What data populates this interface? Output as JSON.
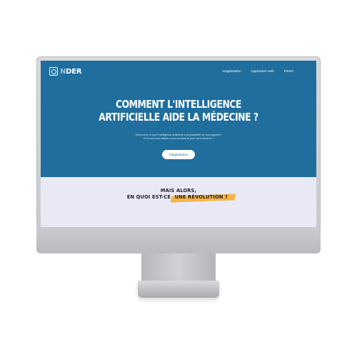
{
  "brand": {
    "logo_prefix": "N",
    "logo_suffix": "DER"
  },
  "nav": {
    "items": [
      {
        "label": "Vulgarisation"
      },
      {
        "label": "Application web"
      },
      {
        "label": "Forum"
      }
    ]
  },
  "hero": {
    "title_line1": "COMMENT L'INTELLIGENCE",
    "title_line2": "ARTIFICIELLE AIDE LA MÉDECINE ?",
    "subtitle_line1": "Découvrez ce que l'intelligence artificielle a la possibilité de vous apporter.",
    "subtitle_line2": "Et si cela vous effraie, nous sommes là pour vous informer !",
    "button_label": "Vulgarisation"
  },
  "section": {
    "line1": "MAIS ALORS,",
    "line2_prefix": "EN QUOI EST-CE ",
    "line2_highlight": "UNE RÉVOLUTION ?"
  },
  "colors": {
    "hero_bg": "#1f6e9d",
    "section_bg": "#e9e9f6",
    "highlight": "#f6b447",
    "monitor": "#c9cbce"
  }
}
